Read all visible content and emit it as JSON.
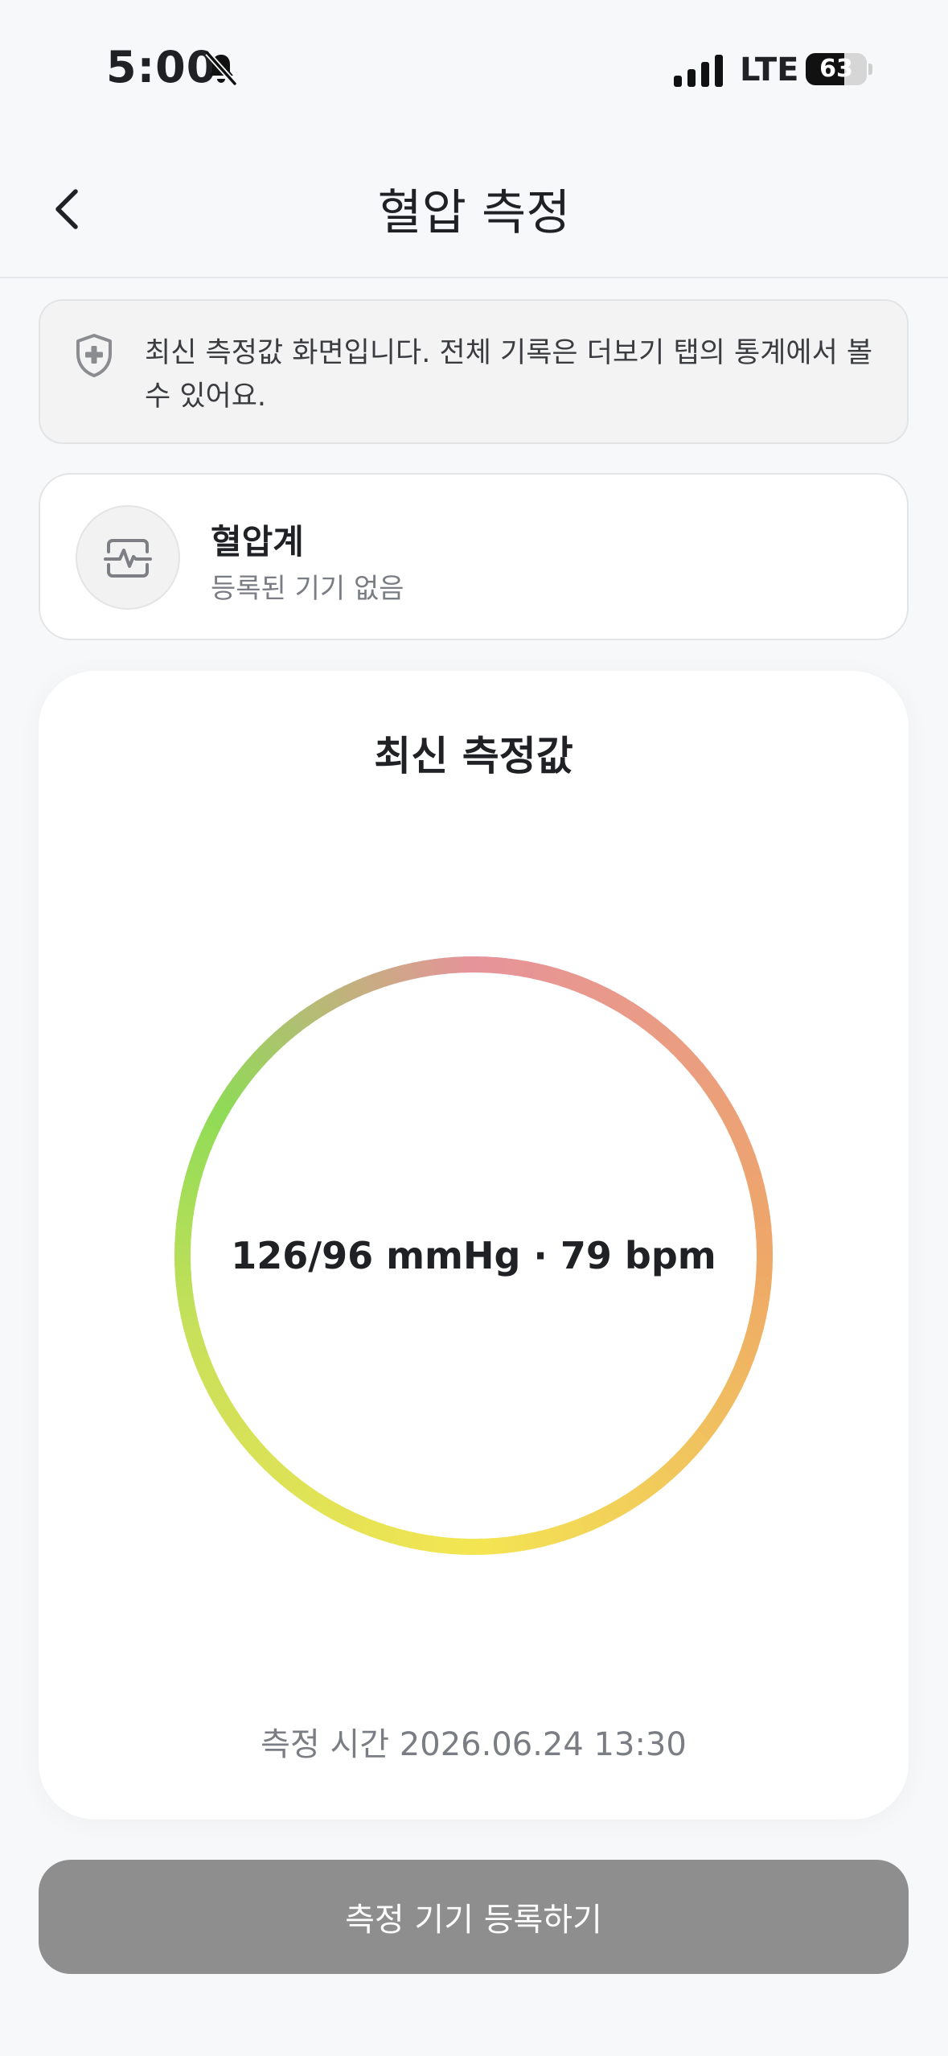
{
  "status_bar": {
    "time": "5:00",
    "network": "LTE",
    "battery": "63",
    "battery_level": 0.63
  },
  "header": {
    "title": "혈압 측정",
    "back_icon": "chevron-left-icon"
  },
  "notice": {
    "icon": "shield-plus-icon",
    "text": "최신 측정값 화면입니다. 전체 기록은 더보기 탭의 통계에서 볼 수 있어요."
  },
  "device": {
    "icon": "pulse-monitor-icon",
    "name": "혈압계",
    "status": "등록된 기기 없음"
  },
  "measurement": {
    "title": "최신 측정값",
    "value": "126/96 mmHg · 79 bpm",
    "time_label": "측정 시간 2026.06.24 13:30"
  },
  "actions": {
    "register_button": "측정 기기 등록하기"
  },
  "colors": {
    "background": "#f7f8fa",
    "button_disabled": "#8e8e8e",
    "ring_green": "#8fdb57",
    "ring_pink": "#e6939a",
    "ring_orange": "#eea768",
    "ring_yellow": "#f4e552"
  }
}
